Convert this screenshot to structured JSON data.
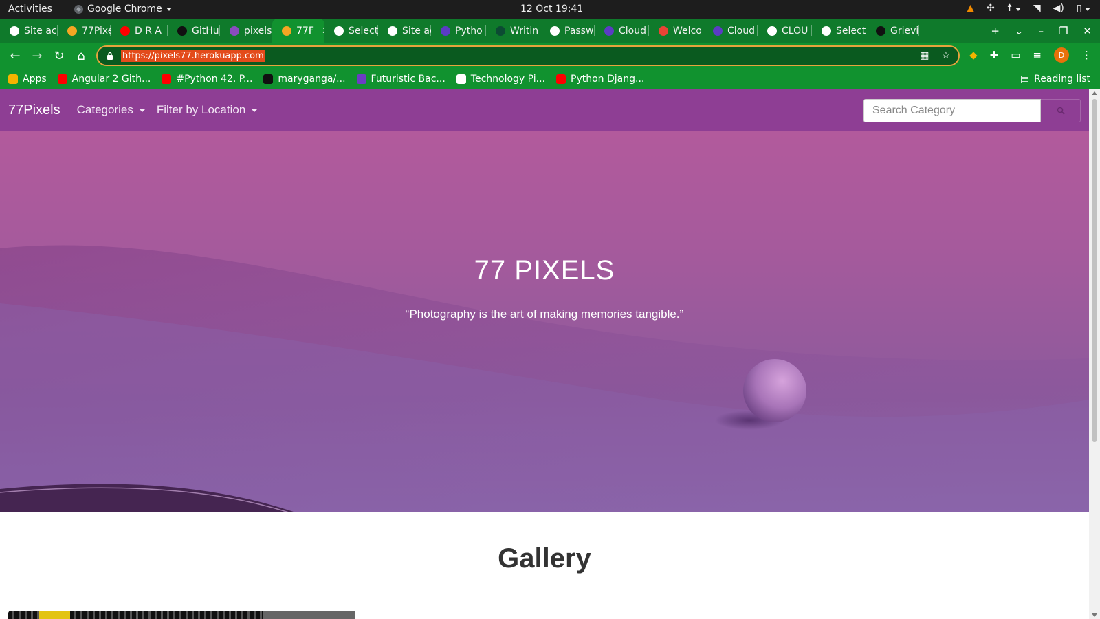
{
  "os_bar": {
    "activities": "Activities",
    "app_name": "Google Chrome",
    "clock": "12 Oct  19:41"
  },
  "tabs": [
    {
      "label": "Site ac",
      "icon": "globe-icon",
      "color": "#ffffff"
    },
    {
      "label": "77Pixe",
      "icon": "page-icon",
      "color": "#f5a623"
    },
    {
      "label": "D R A",
      "icon": "youtube-icon",
      "color": "#ff0000"
    },
    {
      "label": "GitHu",
      "icon": "github-icon",
      "color": "#111111"
    },
    {
      "label": "pixels",
      "icon": "heroku-icon",
      "color": "#8a4cc0"
    },
    {
      "label": "77F",
      "icon": "page-icon",
      "color": "#f5a623",
      "active": true
    },
    {
      "label": "Select",
      "icon": "globe-icon",
      "color": "#ffffff"
    },
    {
      "label": "Site ac",
      "icon": "globe-icon",
      "color": "#ffffff"
    },
    {
      "label": "Pytho",
      "icon": "cloud-icon",
      "color": "#5b3cc4"
    },
    {
      "label": "Writin",
      "icon": "django-icon",
      "color": "#0c4b33"
    },
    {
      "label": "Passw",
      "icon": "google-icon",
      "color": "#ffffff"
    },
    {
      "label": "Cloud",
      "icon": "cloud-icon",
      "color": "#5b3cc4"
    },
    {
      "label": "Welco",
      "icon": "gmail-icon",
      "color": "#ea4335"
    },
    {
      "label": "Cloud",
      "icon": "cloud-icon",
      "color": "#5b3cc4"
    },
    {
      "label": "CLOU",
      "icon": "google-icon",
      "color": "#ffffff"
    },
    {
      "label": "Select",
      "icon": "globe-icon",
      "color": "#ffffff"
    },
    {
      "label": "Grievi",
      "icon": "github-icon",
      "color": "#111111"
    }
  ],
  "toolbar": {
    "url": "https://pixels77.herokuapp.com",
    "profile_initial": "D"
  },
  "bookmarks": [
    {
      "label": "Apps",
      "color": "#f4b400"
    },
    {
      "label": "Angular 2 Gith...",
      "color": "#ff0000"
    },
    {
      "label": "#Python 42. P...",
      "color": "#ff0000"
    },
    {
      "label": "maryganga/...",
      "color": "#111111"
    },
    {
      "label": "Futuristic Bac...",
      "color": "#6c3cc4"
    },
    {
      "label": "Technology Pi...",
      "color": "#ffffff"
    },
    {
      "label": "Python Djang...",
      "color": "#ff0000"
    }
  ],
  "reading_list": "Reading list",
  "site": {
    "brand": "77Pixels",
    "nav": [
      "Categories",
      "Filter by Location"
    ],
    "search_placeholder": "Search Category",
    "hero_title": "77 PIXELS",
    "hero_quote": "“Photography is the art of making memories tangible.”",
    "gallery_title": "Gallery"
  },
  "colors": {
    "chrome_frame": "#0f7a2b",
    "chrome_toolbar": "#11922f",
    "site_nav": "#8e3e94",
    "url_highlight": "#e34b1b"
  }
}
